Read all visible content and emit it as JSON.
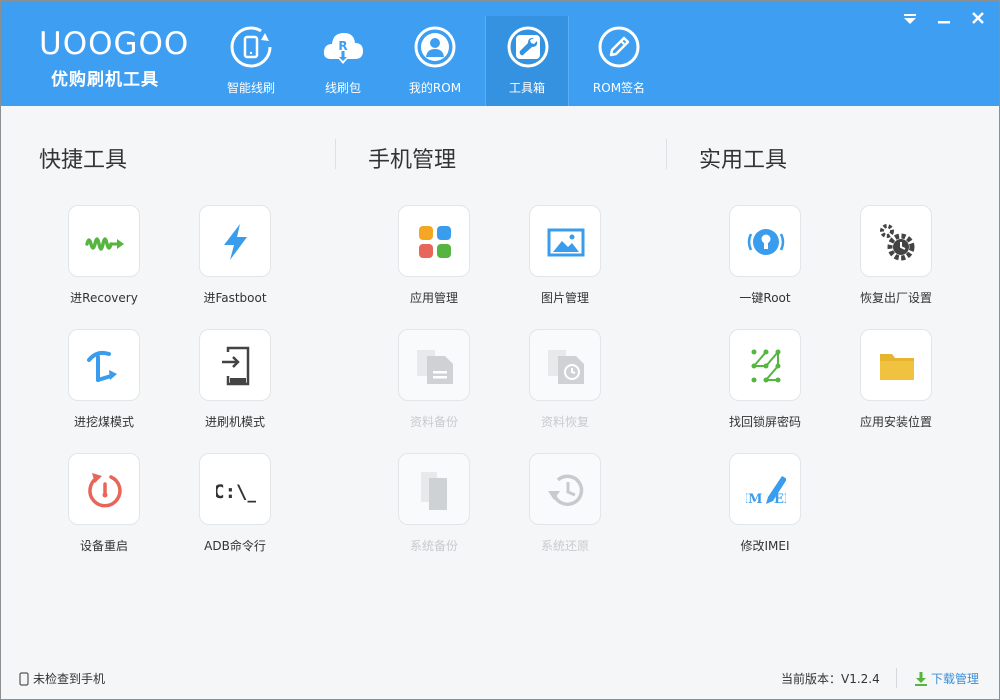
{
  "app": {
    "logo_text": "UOOGOO",
    "logo_subtitle": "优购刷机工具"
  },
  "nav": [
    {
      "label": "智能线刷",
      "icon": "phone-refresh-icon",
      "active": false
    },
    {
      "label": "线刷包",
      "icon": "cloud-download-icon",
      "active": false
    },
    {
      "label": "我的ROM",
      "icon": "user-icon",
      "active": false
    },
    {
      "label": "工具箱",
      "icon": "wrench-icon",
      "active": true
    },
    {
      "label": "ROM签名",
      "icon": "pen-icon",
      "active": false
    }
  ],
  "sections": {
    "quick_tools": {
      "title": "快捷工具",
      "items": [
        {
          "label": "进Recovery",
          "icon": "recovery-wave-icon",
          "enabled": true
        },
        {
          "label": "进Fastboot",
          "icon": "lightning-icon",
          "enabled": true
        },
        {
          "label": "进挖煤模式",
          "icon": "pickaxe-icon",
          "enabled": true
        },
        {
          "label": "进刷机模式",
          "icon": "phone-enter-icon",
          "enabled": true
        },
        {
          "label": "设备重启",
          "icon": "restart-icon",
          "enabled": true
        },
        {
          "label": "ADB命令行",
          "icon": "terminal-icon",
          "enabled": true
        }
      ],
      "terminal_glyph": "C:\\_"
    },
    "phone_manage": {
      "title": "手机管理",
      "items": [
        {
          "label": "应用管理",
          "icon": "apps-grid-icon",
          "enabled": true
        },
        {
          "label": "图片管理",
          "icon": "picture-icon",
          "enabled": true
        },
        {
          "label": "资料备份",
          "icon": "document-backup-icon",
          "enabled": false
        },
        {
          "label": "资料恢复",
          "icon": "document-restore-icon",
          "enabled": false
        },
        {
          "label": "系统备份",
          "icon": "system-backup-icon",
          "enabled": false
        },
        {
          "label": "系统还原",
          "icon": "history-icon",
          "enabled": false
        }
      ]
    },
    "utilities": {
      "title": "实用工具",
      "items": [
        {
          "label": "一键Root",
          "icon": "root-lock-icon",
          "enabled": true
        },
        {
          "label": "恢复出厂设置",
          "icon": "gears-clock-icon",
          "enabled": true
        },
        {
          "label": "找回锁屏密码",
          "icon": "pattern-lock-icon",
          "enabled": true
        },
        {
          "label": "应用安装位置",
          "icon": "folder-icon",
          "enabled": true
        },
        {
          "label": "修改IMEI",
          "icon": "imei-edit-icon",
          "enabled": true
        }
      ],
      "imei_glyph_left": "IM",
      "imei_glyph_right": "EI"
    }
  },
  "status": {
    "phone_status": "未检查到手机",
    "version_label": "当前版本：V1.2.4",
    "download_label": "下载管理"
  },
  "colors": {
    "topbar": "#3d9ef2",
    "accent_green": "#56b440",
    "accent_blue": "#3a9cec",
    "accent_red": "#e8655a",
    "folder_yellow": "#e7b42f"
  }
}
